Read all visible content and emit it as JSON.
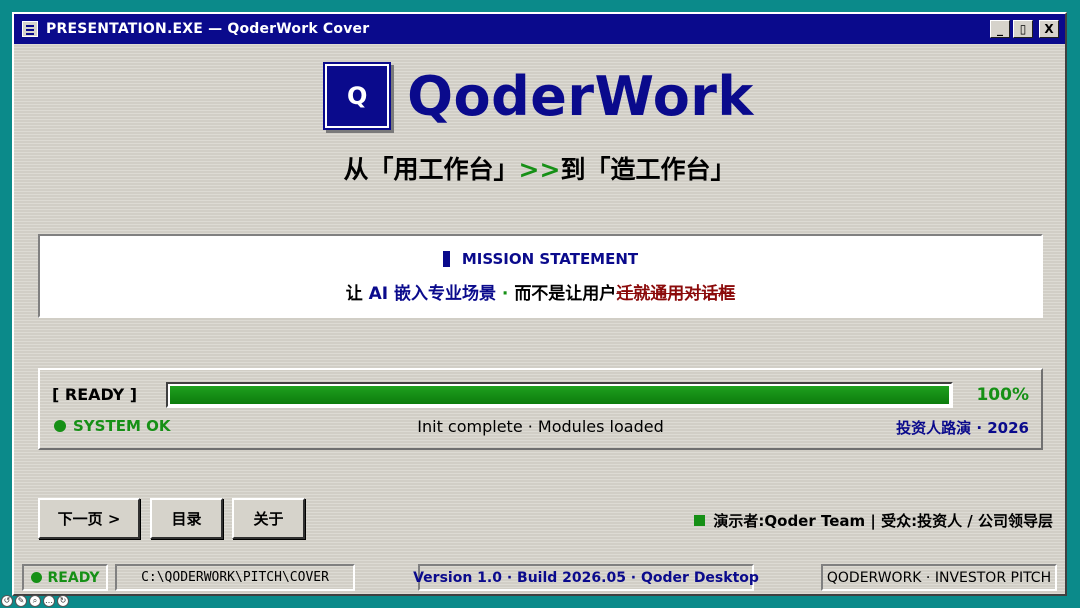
{
  "window": {
    "title": "PRESENTATION.EXE — QoderWork Cover",
    "controls": {
      "minimize": "_",
      "maximize": "▯",
      "close": "X"
    }
  },
  "logo": {
    "letter": "Q",
    "name": "QoderWork"
  },
  "subtitle": {
    "part1": "从「用工作台」",
    "arrow": ">>",
    "part2": "到「造工作台」"
  },
  "mission": {
    "heading": "MISSION STATEMENT",
    "text_prefix": "让 ",
    "text_highlight": "AI 嵌入专业场景",
    "separator": " · ",
    "text_middle": "而不是让用户",
    "text_struck": "迁就通用对话框"
  },
  "progress": {
    "label": "[ READY ]",
    "percent_text": "100%",
    "fill_fraction": 1.0,
    "status": "SYSTEM OK",
    "message": "Init complete · Modules loaded",
    "event": "投资人路演 · 2026"
  },
  "buttons": {
    "next": "下一页 >",
    "toc": "目录",
    "about": "关于"
  },
  "presenter": "演示者:Qoder Team | 受众:投资人 / 公司领导层",
  "statusbar": {
    "ready": "READY",
    "path": "C:\\QODERWORK\\PITCH\\COVER",
    "version": "Version 1.0 · Build 2026.05 · Qoder Desktop",
    "pitch": "QODERWORK · INVESTOR PITCH"
  },
  "colors": {
    "title_bar": "#0a0a8c",
    "accent_blue": "#0a0a8c",
    "ok_green": "#169016",
    "strike_red": "#8b0a0a",
    "window_face": "#d6d3cb",
    "desktop": "#0b8a8a"
  },
  "viewer_controls": [
    "rotate-left-icon",
    "pen-icon",
    "zoom-icon",
    "more-icon",
    "rotate-right-icon"
  ]
}
